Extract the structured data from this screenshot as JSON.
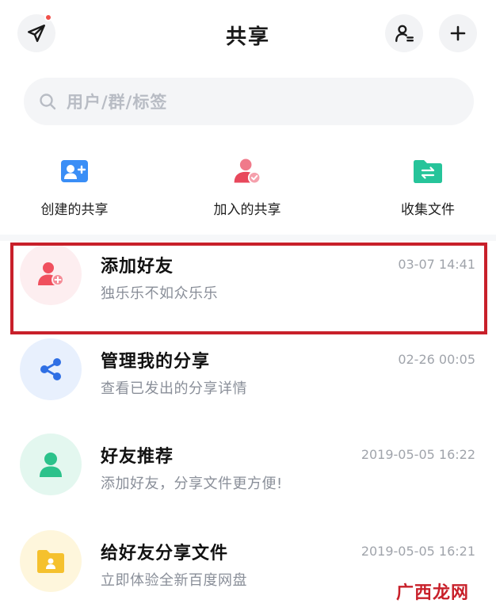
{
  "header": {
    "title": "共享"
  },
  "search": {
    "placeholder": "用户/群/标签"
  },
  "quick_actions": [
    {
      "label": "创建的共享",
      "icon": "person-add-icon"
    },
    {
      "label": "加入的共享",
      "icon": "joined-share-icon"
    },
    {
      "label": "收集文件",
      "icon": "folder-exchange-icon"
    }
  ],
  "list": [
    {
      "title": "添加好友",
      "subtitle": "独乐乐不如众乐乐",
      "time": "03-07 14:41",
      "icon": "add-friend-icon"
    },
    {
      "title": "管理我的分享",
      "subtitle": "查看已发出的分享详情",
      "time": "02-26 00:05",
      "icon": "share-icon"
    },
    {
      "title": "好友推荐",
      "subtitle": "添加好友，分享文件更方便!",
      "time": "2019-05-05 16:22",
      "icon": "person-icon"
    },
    {
      "title": "给好友分享文件",
      "subtitle": "立即体验全新百度网盘",
      "time": "2019-05-05 16:21",
      "icon": "folder-icon"
    }
  ],
  "watermark": "广西龙网",
  "colors": {
    "highlight": "#c8202a",
    "red_accent": "#f0504a",
    "blue_accent": "#2f6fe4",
    "green_accent": "#2cc28b",
    "yellow_accent": "#f5c12e"
  }
}
